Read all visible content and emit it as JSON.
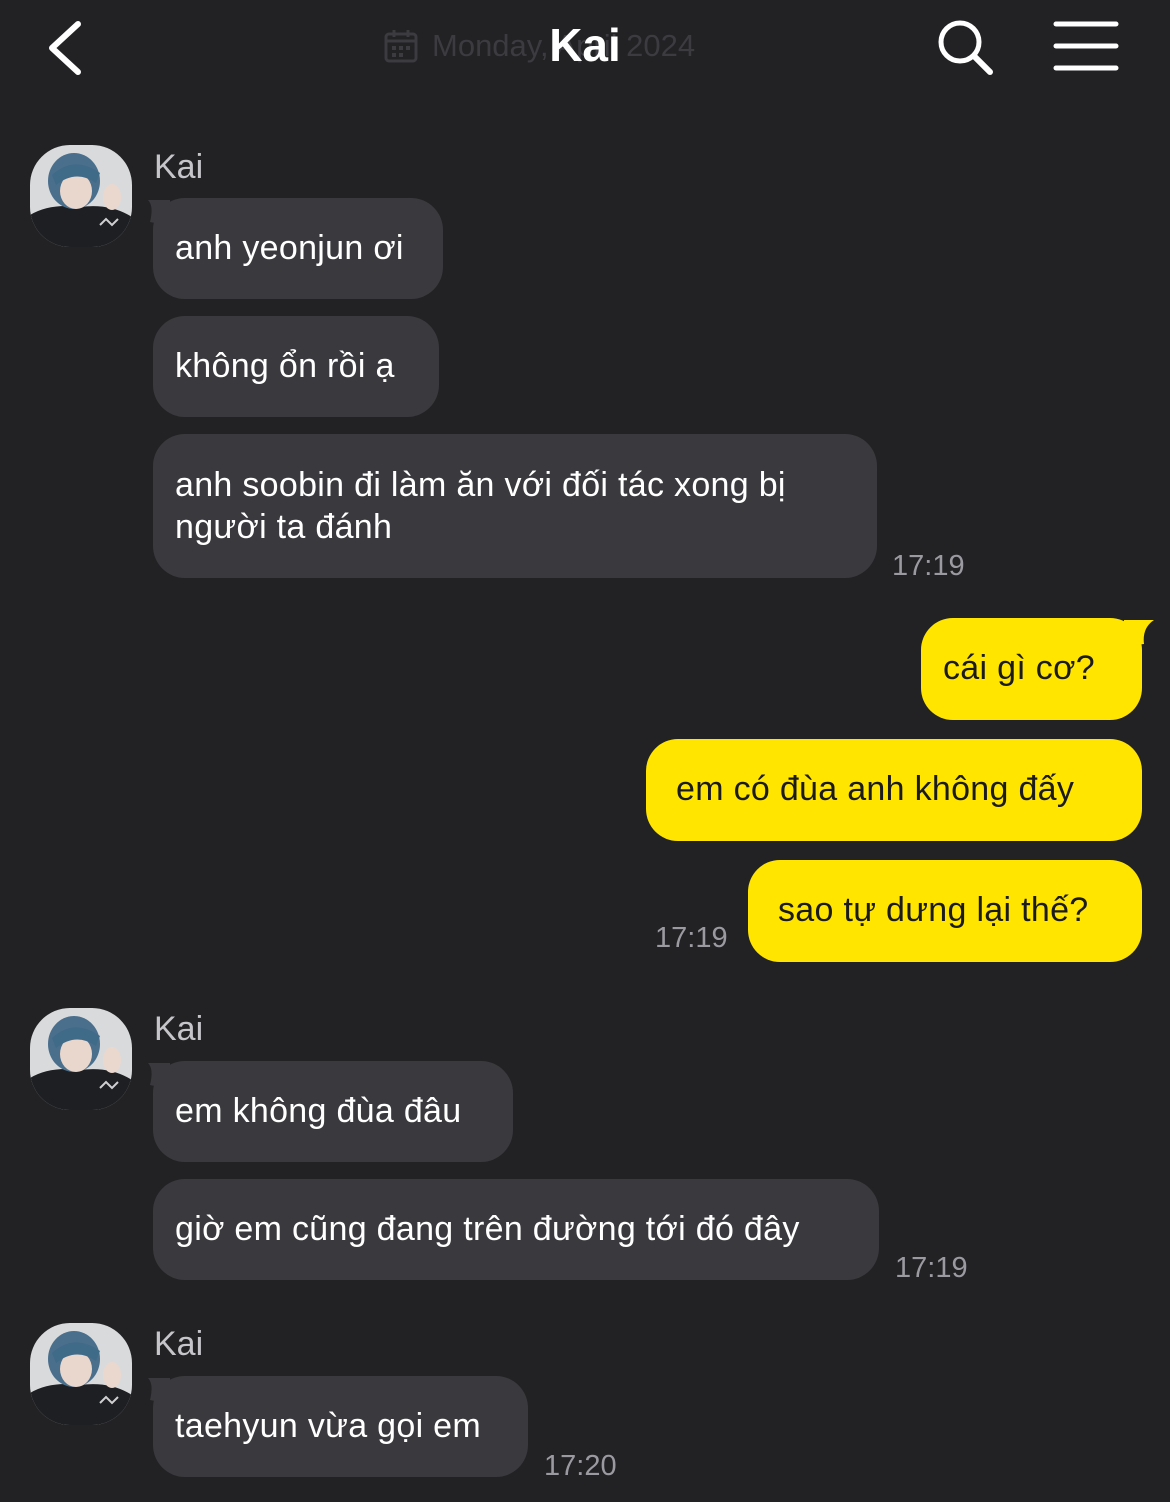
{
  "header": {
    "title": "Kai",
    "date_hint": "Monday, April 2024"
  },
  "colors": {
    "background": "#222225",
    "incoming_bubble": "#3a3a3e",
    "outgoing_bubble": "#ffe500"
  },
  "messages": [
    {
      "sender": "Kai",
      "bubbles": [
        "anh yeonjun ơi",
        "không ổn rồi ạ",
        "anh soobin đi làm ăn với đối tác xong bị người ta đánh"
      ],
      "time": "17:19"
    },
    {
      "sender": "me",
      "bubbles": [
        "cái gì cơ?",
        "em có đùa anh không đấy",
        "sao tự dưng lại thế?"
      ],
      "time": "17:19"
    },
    {
      "sender": "Kai",
      "bubbles": [
        "em không đùa đâu",
        "giờ em cũng đang trên đường tới đó đây"
      ],
      "time": "17:19"
    },
    {
      "sender": "Kai",
      "bubbles": [
        "taehyun vừa gọi em"
      ],
      "time": "17:20"
    }
  ]
}
